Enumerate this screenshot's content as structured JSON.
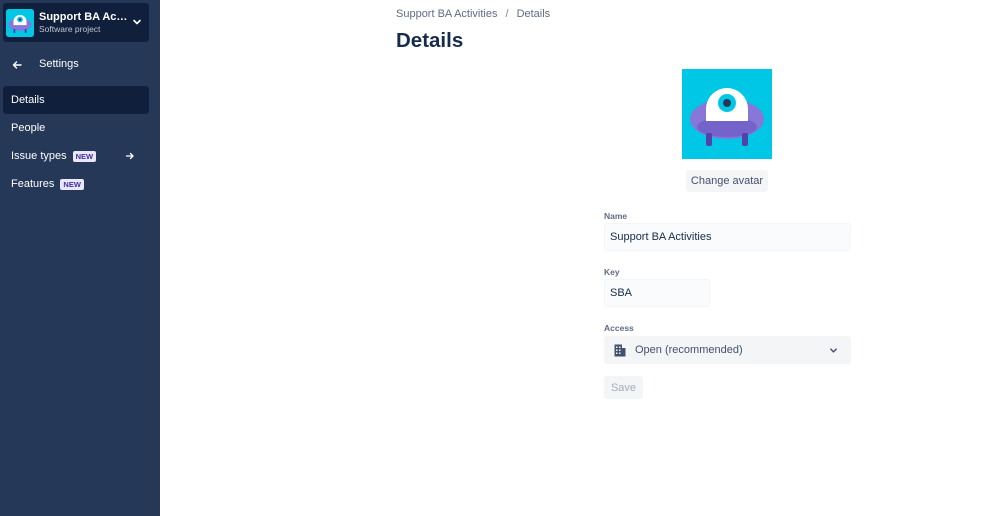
{
  "project": {
    "name": "Support BA Activities",
    "type": "Software project",
    "avatar_icon": "ufo-robot-avatar-icon",
    "avatar_bg": "#00c7e5"
  },
  "sidebar": {
    "back_label": "Settings",
    "items": [
      {
        "label": "Details",
        "active": true
      },
      {
        "label": "People"
      },
      {
        "label": "Issue types",
        "badge": "NEW",
        "has_arrow": true
      },
      {
        "label": "Features",
        "badge": "NEW"
      }
    ]
  },
  "breadcrumb": {
    "items": [
      "Support BA Activities",
      "Details"
    ],
    "separator": "/"
  },
  "page": {
    "title": "Details"
  },
  "avatar_section": {
    "change_label": "Change avatar"
  },
  "form": {
    "name_label": "Name",
    "name_value": "Support BA Activities",
    "key_label": "Key",
    "key_value": "SBA",
    "access_label": "Access",
    "access_value": "Open (recommended)",
    "access_icon": "building-icon",
    "save_label": "Save"
  },
  "colors": {
    "sidebar_bg": "#253858",
    "sidebar_active": "#0f1f3c",
    "badge_bg": "#eae6ff",
    "badge_text": "#403294"
  }
}
